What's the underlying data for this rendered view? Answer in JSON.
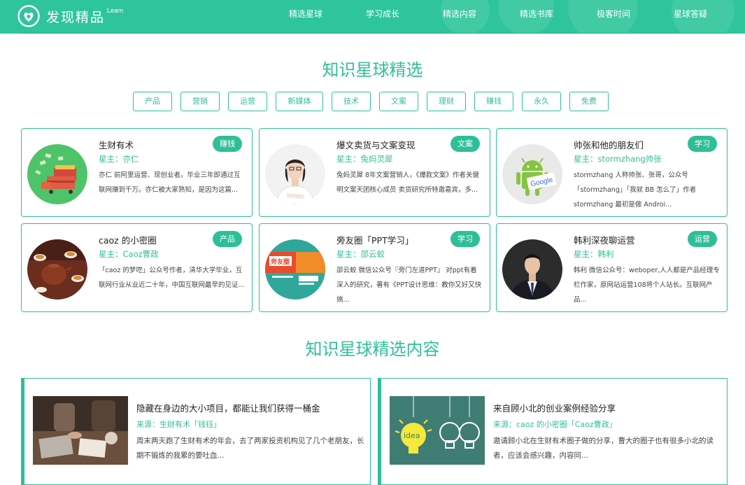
{
  "header": {
    "logo_text": "发现精品",
    "logo_sup": "Learn",
    "nav": [
      "精选星球",
      "学习成长",
      "精选内容",
      "精选书库",
      "极客时间",
      "星球答疑"
    ]
  },
  "section1": {
    "title": "知识星球精选"
  },
  "tags": [
    "产品",
    "营销",
    "运营",
    "新媒体",
    "技术",
    "文案",
    "理财",
    "赚钱",
    "永久",
    "免费"
  ],
  "cards": [
    {
      "title": "生财有术",
      "owner": "星主：亦仁",
      "badge": "赚钱",
      "desc": "亦仁 前阿里运营、现创业者。毕业三年即通过互联网赚到千万。亦仁被大家熟知，是因为这篇..."
    },
    {
      "title": "爆文卖货与文案变现",
      "owner": "星主：兔妈灵犀",
      "badge": "文案",
      "desc": "兔妈灵犀 8年文案营销人，《爆款文案》作者关健明文案天团核心成员 卖货研究所特邀嘉宾，多..."
    },
    {
      "title": "帅张和他的朋友们",
      "owner": "星主：stormzhang帅张",
      "badge": "学习",
      "desc": "stormzhang 人称帅张、张哥，公众号「stormzhang」「我就 BB 怎么了」作者 stormzhang 最初是做 Androi..."
    },
    {
      "title": "caoz 的小密圈",
      "owner": "星主：Caoz曹政",
      "badge": "产品",
      "desc": "「caoz 的梦呓」公众号作者，清华大学毕业，互联网行业从业近二十年，中国互联网最早的见证..."
    },
    {
      "title": "旁友圈「PPT学习」",
      "owner": "星主：邵云蛟",
      "badge": "学习",
      "desc": "邵云蛟 微信公众号『旁门左道PPT』 对ppt有着深入的研究，著有《PPT设计思维：教你又好又快搞..."
    },
    {
      "title": "韩利深夜聊运营",
      "owner": "星主：韩利",
      "badge": "运营",
      "desc": "韩利 微信公众号：weboper,人人都是产品经理专栏作家，原网站运营108将个人站长。互联网产品..."
    }
  ],
  "section2": {
    "title": "知识星球精选内容"
  },
  "contents": [
    {
      "title": "隐藏在身边的大小项目，都能让我们获得一桶金",
      "source": "来源：生财有术「钱钰」",
      "desc": "周末两天跑了生财有术的年会，去了两家投资机构见了几个老朋友，长期不锻炼的我累的要吐血..."
    },
    {
      "title": "来自顾小北的创业案例经验分享",
      "source": "来源：caoz 的小密圈「Caoz曹政」",
      "desc": "邀请顾小北在生财有术圈子做的分享，曹大的圈子也有很多小北的读者，应该会感兴趣，内容同..."
    }
  ],
  "images": {
    "ppt_cover_text": "旁友圈",
    "idea_text": "idea",
    "google_text": "Google"
  },
  "colors": {
    "accent": "#2fbf98",
    "header": "#2fc59c"
  }
}
